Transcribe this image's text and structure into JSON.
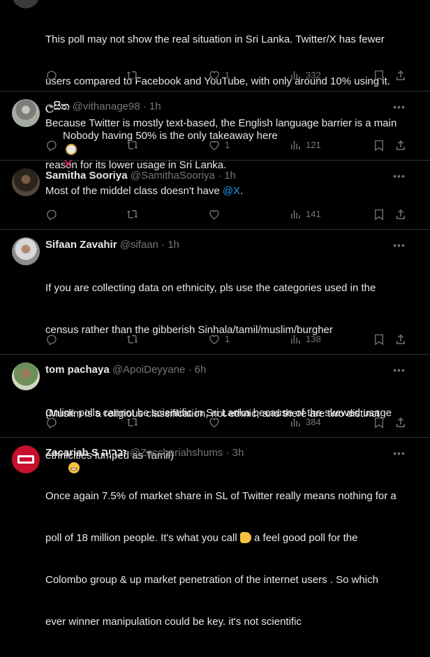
{
  "tweets": [
    {
      "body_lines": [
        "This poll may not show the real situation in Sri Lanka. Twitter/X has fewer",
        "users compared to Facebook and YouTube, with only around 10% using it.",
        "Because Twitter is mostly text-based, the English language barrier is a main",
        "reason for its lower usage in Sri Lanka."
      ],
      "likes": "1",
      "views": "332"
    },
    {
      "name": "ලසිත",
      "handle": "@vithanage98",
      "time": "1h",
      "body": "Nobody having 50% is the only takeaway here",
      "likes": "1",
      "views": "121"
    },
    {
      "name": "Samitha Sooriya",
      "handle": "@SamithaSooriya",
      "time": "1h",
      "body": "Most of the middel class doesn't have ",
      "mention": "@X",
      "body_after": ".",
      "likes": "",
      "views": "141"
    },
    {
      "name": "Sifaan Zavahir",
      "handle": "@sifaan",
      "time": "1h",
      "body_lines": [
        "If you are collecting data on ethnicity, pls use the categories used in the",
        "census rather than the gibberish Sinhala/tamil/muslim/burgher",
        "",
        "(Muslim is a religious classification, not ethnic; and there are two distinct",
        "ethnicities lumped as Tamil)"
      ],
      "likes": "1",
      "views": "138"
    },
    {
      "name": "tom pachaya",
      "handle": "@ApoiDeyyane",
      "time": "6h",
      "body_lines": [
        "Online polls cannot be scientific in Sri Lanka because of the skewed usage"
      ],
      "likes": "",
      "views": "384"
    },
    {
      "name": "Zacariah S זְכַרְיָה",
      "handle": "@Zacchariahshums",
      "time": "3h",
      "body_lines": [
        "Once again 7.5% of market share in SL of Twitter really means nothing for a",
        "poll of 18 million people. It's what you call ",
        "Colombo group & up market penetration of the internet users . So which",
        "ever winner manipulation could be key. it's not scientific"
      ],
      "body_line2_after_emoji": " a feel good poll for the"
    }
  ],
  "icons": {
    "reply": "reply-icon",
    "retweet": "retweet-icon",
    "like": "heart-icon",
    "views": "views-icon",
    "bookmark": "bookmark-icon",
    "share": "share-icon",
    "more": "more-icon"
  },
  "colors": {
    "background": "#000000",
    "text": "#e7e9ea",
    "muted": "#71767b",
    "link": "#1d9bf0",
    "border": "#2f3336"
  }
}
